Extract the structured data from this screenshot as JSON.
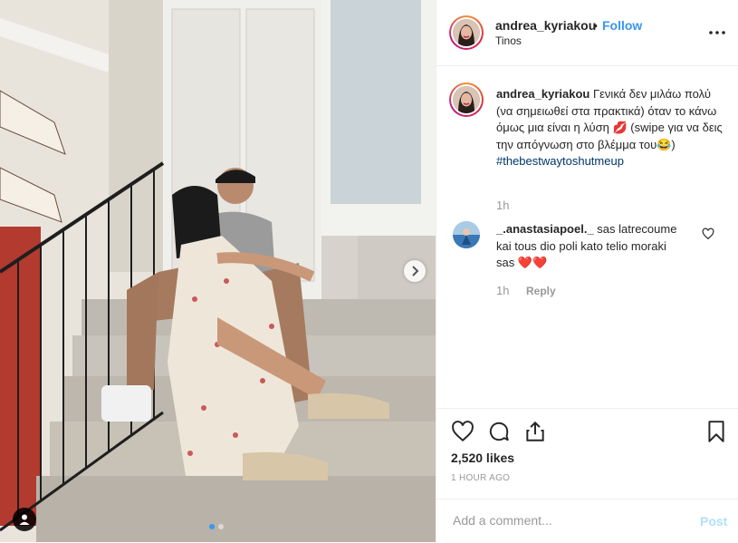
{
  "post": {
    "username": "andrea_kyriakou",
    "separator": "•",
    "follow_label": "Follow",
    "location": "Tinos",
    "more_icon": "more-horizontal-icon",
    "photo_count": 2,
    "current_photo": 1
  },
  "caption": {
    "username": "andrea_kyriakou",
    "text_part1": "Γενικά δεν μιλάω πολύ (να σημειωθεί στα πρακτικά) όταν το κάνω όμως μια είναι η λύση",
    "emoji1": "💋",
    "text_part2": "(swipe για να δεις την απόγνωση στο βλέμμα του",
    "emoji2": "😂",
    "text_part3": ")",
    "hashtag": "#thebestwaytoshutmeup",
    "time": "1h"
  },
  "comment": {
    "username": "_.anastasiapoel._",
    "text": "sas latrecoume kai tous dio poli kato telio moraki sas",
    "emoji": "❤️❤️",
    "time": "1h",
    "reply_label": "Reply"
  },
  "engagement": {
    "likes": "2,520 likes",
    "time_ago": "1 HOUR AGO"
  },
  "add_comment": {
    "placeholder": "Add a comment...",
    "post_label": "Post"
  },
  "colors": {
    "accent_blue": "#3897f0",
    "hashtag": "#003569",
    "muted": "#999999",
    "post_disabled": "#b2dffc",
    "border": "#efefef"
  }
}
